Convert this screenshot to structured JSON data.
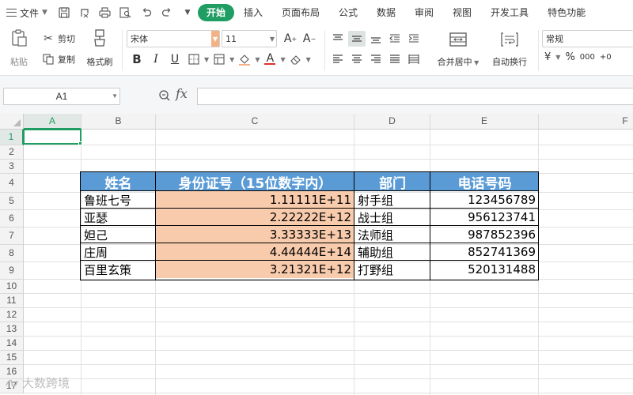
{
  "menubar": {
    "file_label": "文件",
    "tabs": [
      "开始",
      "插入",
      "页面布局",
      "公式",
      "数据",
      "审阅",
      "视图",
      "开发工具",
      "特色功能"
    ],
    "active_tab": "开始"
  },
  "ribbon": {
    "paste": "粘贴",
    "cut": "剪切",
    "copy": "复制",
    "format_painter": "格式刷",
    "font_name": "宋体",
    "font_size": "11",
    "merge_center": "合并居中",
    "wrap_text": "自动换行",
    "number_format": "常规",
    "currency_symbol": "¥",
    "percent_symbol": "%",
    "thousands_symbol": "000",
    "decimal_symbol": "+0"
  },
  "formula_bar": {
    "name_box": "A1",
    "fx_label": "fx",
    "formula": ""
  },
  "sheet": {
    "columns": [
      "A",
      "B",
      "C",
      "D",
      "E",
      "F"
    ],
    "rows": [
      "1",
      "2",
      "3",
      "4",
      "5",
      "6",
      "7",
      "8",
      "9",
      "10",
      "11",
      "12",
      "13",
      "14",
      "15",
      "16",
      "17"
    ],
    "headers": [
      "姓名",
      "身份证号（15位数字内）",
      "部门",
      "电话号码"
    ],
    "data": [
      [
        "鲁班七号",
        "1.11111E+11",
        "射手组",
        "123456789"
      ],
      [
        "亚瑟",
        "2.22222E+12",
        "战士组",
        "956123741"
      ],
      [
        "妲己",
        "3.33333E+13",
        "法师组",
        "987852396"
      ],
      [
        "庄周",
        "4.44444E+14",
        "辅助组",
        "852741369"
      ],
      [
        "百里玄策",
        "3.21321E+12",
        "打野组",
        "520131488"
      ]
    ]
  },
  "watermark": "大数跨境",
  "colors": {
    "accent": "#1f9d62",
    "header_fill": "#5b9bd5",
    "id_fill": "#f8cbad"
  }
}
